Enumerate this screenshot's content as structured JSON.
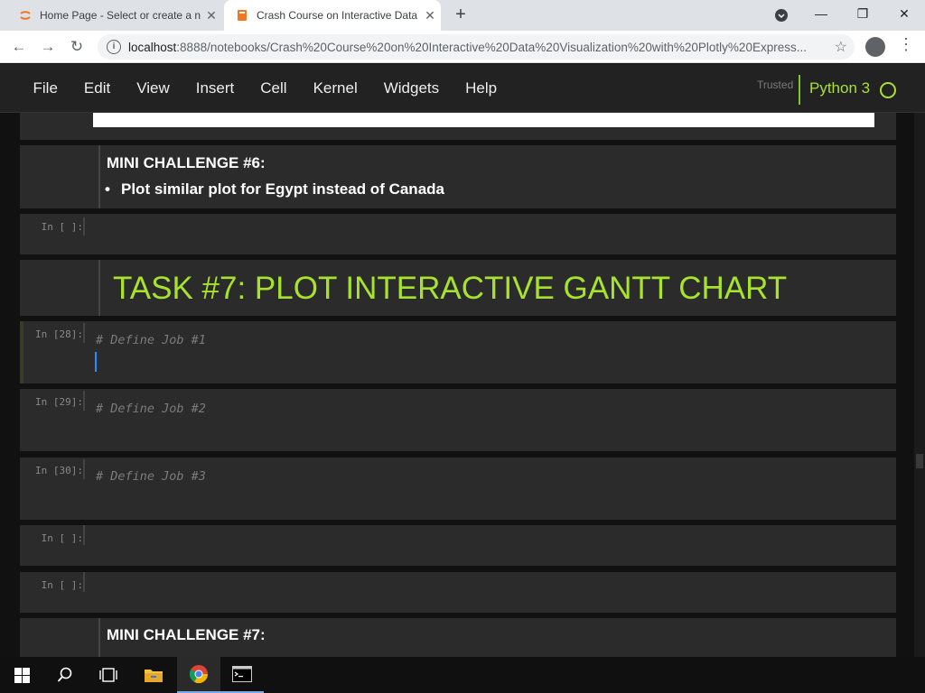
{
  "browser": {
    "tabs": [
      {
        "title": "Home Page - Select or create a n",
        "close": "✕"
      },
      {
        "title": "Crash Course on Interactive Data",
        "close": "✕"
      }
    ],
    "new_tab": "+",
    "url_host": "localhost",
    "url_path": ":8888/notebooks/Crash%20Course%20on%20Interactive%20Data%20Visualization%20with%20Plotly%20Express...",
    "window_controls": {
      "minimize": "—",
      "maximize": "❐",
      "close": "✕"
    }
  },
  "jupyter": {
    "menu": [
      "File",
      "Edit",
      "View",
      "Insert",
      "Cell",
      "Kernel",
      "Widgets",
      "Help"
    ],
    "trusted": "Trusted",
    "kernel": "Python 3"
  },
  "cells": {
    "mini6_title": "MINI CHALLENGE #6:",
    "mini6_bullet": "Plot similar plot for Egypt instead of Canada",
    "empty_prompt": "In [ ]:",
    "task7_heading": "TASK #7: PLOT INTERACTIVE GANTT CHART",
    "c28_prompt": "In [28]:",
    "c28_code": "# Define Job #1",
    "c29_prompt": "In [29]:",
    "c29_code": "# Define Job #2",
    "c30_prompt": "In [30]:",
    "c30_code": "# Define Job #3",
    "mini7_title": "MINI CHALLENGE #7:"
  },
  "colors": {
    "accent": "#a6e22e",
    "cell_bg": "#2b2b2b",
    "page_bg": "#111111"
  }
}
